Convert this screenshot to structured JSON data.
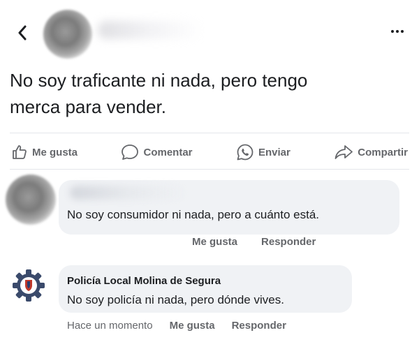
{
  "post": {
    "text_line1": "No soy traficante ni nada, pero tengo",
    "text_line2": "merca para vender."
  },
  "actions": {
    "like": "Me gusta",
    "comment": "Comentar",
    "send": "Enviar",
    "share": "Compartir"
  },
  "comments": [
    {
      "text": "No soy consumidor ni nada, pero a cuánto está.",
      "like": "Me gusta",
      "reply": "Responder"
    },
    {
      "author": "Policía Local Molina de Segura",
      "text": "No soy policía ni nada, pero dónde vives.",
      "time": "Hace un momento",
      "like": "Me gusta",
      "reply": "Responder"
    }
  ],
  "icons": {
    "back": "chevron-left-icon",
    "more": "more-horizontal-icon",
    "like": "thumbs-up-icon",
    "comment": "speech-bubble-icon",
    "send": "whatsapp-icon",
    "share": "share-arrow-icon",
    "police_badge": "gear-badge-icon"
  },
  "colors": {
    "text": "#1c1e21",
    "secondary": "#65676b",
    "bubble": "#f0f2f5",
    "divider": "#e4e6eb"
  }
}
